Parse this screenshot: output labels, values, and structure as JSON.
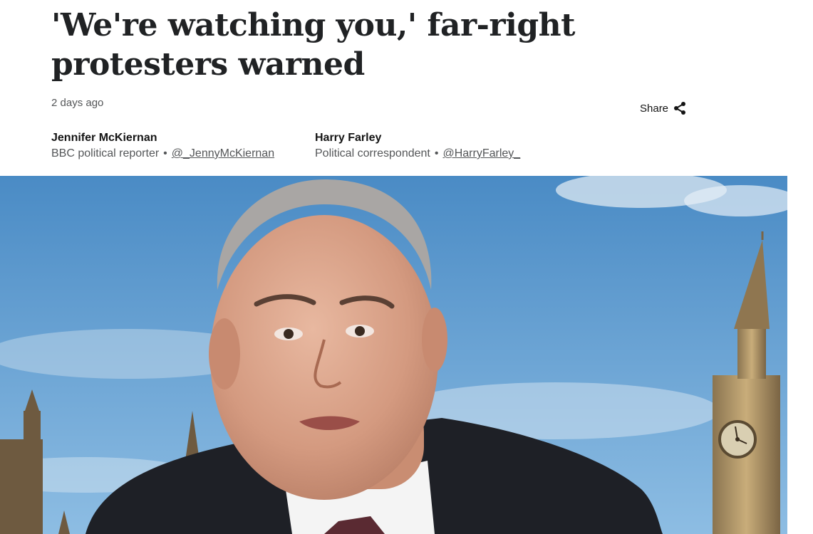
{
  "article": {
    "headline": "'We're watching you,' far-right protesters warned",
    "timestamp": "2 days ago",
    "share_label": "Share"
  },
  "authors": [
    {
      "name": "Jennifer McKiernan",
      "role": "BBC political reporter",
      "handle": "@_JennyMcKiernan"
    },
    {
      "name": "Harry Farley",
      "role": "Political correspondent",
      "handle": "@HarryFarley_"
    }
  ],
  "icons": {
    "share": "share-icon"
  },
  "colors": {
    "text": "#141414",
    "secondary_text": "#545658",
    "sky": "#4f8fc7"
  }
}
